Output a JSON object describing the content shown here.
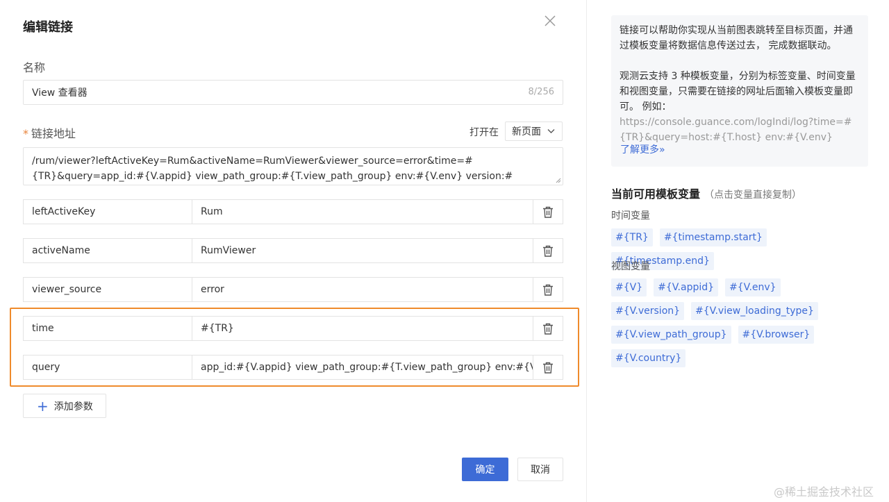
{
  "dialog": {
    "title": "编辑链接",
    "name_label": "名称",
    "name_value": "View 查看器",
    "name_counter": "8/256",
    "url_label": "链接地址",
    "open_in_label": "打开在",
    "open_in_value": "新页面",
    "url_value": "/rum/viewer?leftActiveKey=Rum&activeName=RumViewer&viewer_source=error&time=#{TR}&query=app_id:#{V.appid} view_path_group:#{T.view_path_group} env:#{V.env} version:#{V.version}",
    "params": [
      {
        "key": "leftActiveKey",
        "value": "Rum"
      },
      {
        "key": "activeName",
        "value": "RumViewer"
      },
      {
        "key": "viewer_source",
        "value": "error"
      },
      {
        "key": "time",
        "value": "#{TR}"
      },
      {
        "key": "query",
        "value": "app_id:#{V.appid} view_path_group:#{T.view_path_group} env:#{V.env} version:#{V.version}"
      }
    ],
    "add_param_label": "添加参数",
    "ok_label": "确定",
    "cancel_label": "取消"
  },
  "help": {
    "para1": "链接可以帮助你实现从当前图表跳转至目标页面，并通过模板变量将数据信息传送过去， 完成数据联动。",
    "para2": "观测云支持 3 种模板变量，分别为标签变量、时间变量和视图变量，只需要在链接的网址后面输入模板变量即可。 例如：",
    "example_url": "https://console.guance.com/logIndi/log?time=#{TR}&query=host:#{T.host} env:#{V.env}",
    "learn_more": "了解更多»"
  },
  "variables": {
    "title": "当前可用模板变量",
    "hint": "（点击变量直接复制）",
    "time_group_label": "时间变量",
    "time_vars": [
      "#{TR}",
      "#{timestamp.start}",
      "#{timestamp.end}"
    ],
    "view_group_label": "视图变量",
    "view_vars": [
      "#{V}",
      "#{V.appid}",
      "#{V.env}",
      "#{V.version}",
      "#{V.view_loading_type}",
      "#{V.view_path_group}",
      "#{V.browser}",
      "#{V.country}"
    ]
  },
  "watermark": "@稀土掘金技术社区",
  "colors": {
    "primary": "#3d6bd6",
    "highlight": "#ef8a2b",
    "required": "#e8833a"
  }
}
